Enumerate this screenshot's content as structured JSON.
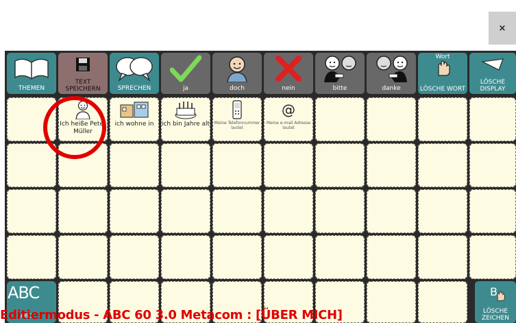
{
  "close_label": "×",
  "toolbar": {
    "themen": "THEMEN",
    "text_speichern": "TEXT SPEICHERN",
    "sprechen": "SPRECHEN",
    "ja": "ja",
    "doch": "doch",
    "nein": "nein",
    "bitte": "bitte",
    "danke": "danke",
    "loesche_wort_top": "Wort",
    "loesche_wort": "LÖSCHE WORT",
    "loesche_display": "LÖSCHE DISPLAY"
  },
  "cells": {
    "ich_heisse": "Ich heiße Peter Müller",
    "ich_wohne": "ich wohne in",
    "ich_bin": "ich bin Jahre alt",
    "telefon": "Meine Telefonnummer lautet",
    "email": "Meine e-mail Adresse lautet",
    "email_symbol": "@"
  },
  "bottom": {
    "abc": "ABC",
    "abc_sub": "ABC",
    "loesche_zeichen_top": "B",
    "loesche_zeichen": "LÖSCHE ZEICHEN"
  },
  "status_text": "Editiermodus - ABC 60 3.0 Metacom : [ÜBER MICH]",
  "colors": {
    "teal": "#3d8b8f",
    "cream": "#fdfbe2",
    "status_red": "#e00000",
    "gray": "#686868"
  }
}
